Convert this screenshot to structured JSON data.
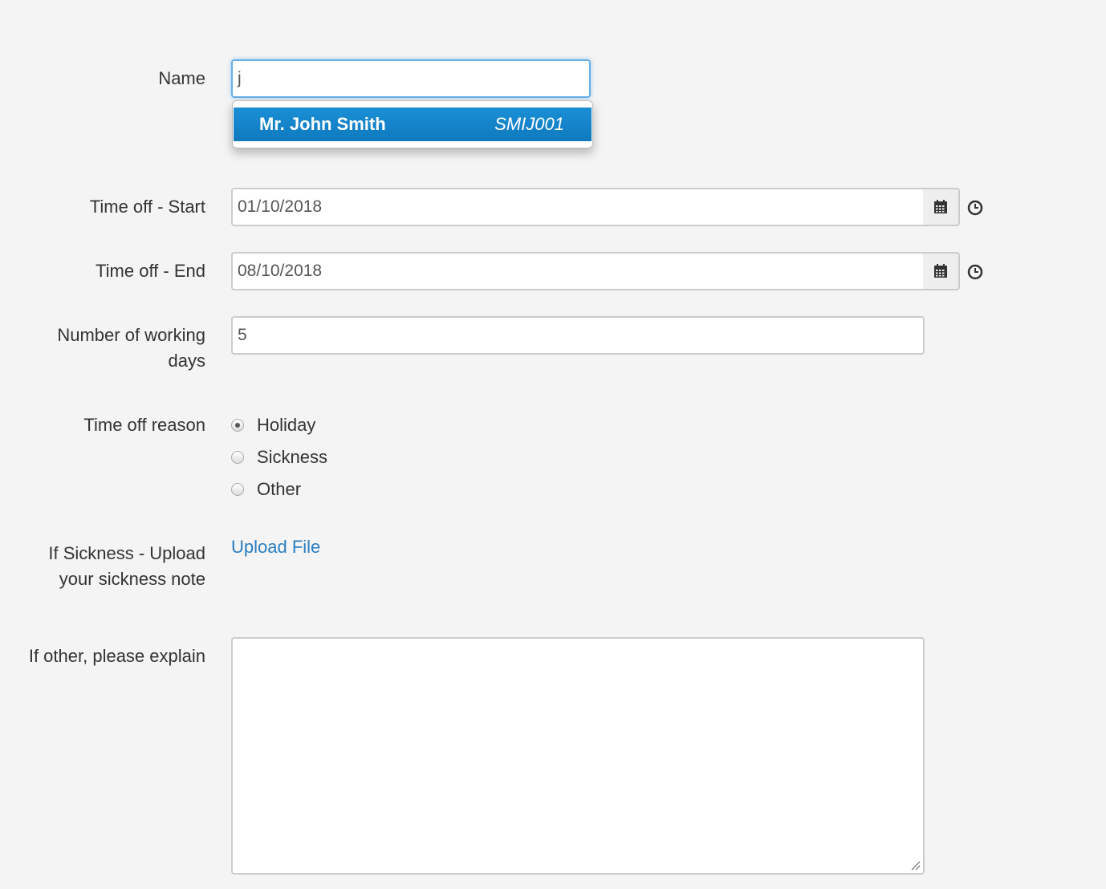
{
  "form": {
    "name": {
      "label": "Name",
      "value": "j"
    },
    "autocomplete": {
      "items": [
        {
          "name": "Mr. John Smith",
          "code": "SMIJ001"
        }
      ]
    },
    "start": {
      "label": "Time off - Start",
      "value": "01/10/2018",
      "calendar_icon": "calendar-icon",
      "clock_icon": "clock-icon"
    },
    "end": {
      "label": "Time off - End",
      "value": "08/10/2018",
      "calendar_icon": "calendar-icon",
      "clock_icon": "clock-icon"
    },
    "working_days": {
      "label": "Number of working days",
      "value": "5"
    },
    "reason": {
      "label": "Time off reason",
      "options": [
        {
          "label": "Holiday",
          "checked": true
        },
        {
          "label": "Sickness",
          "checked": false
        },
        {
          "label": "Other",
          "checked": false
        }
      ]
    },
    "upload": {
      "label": "If Sickness - Upload your sickness note",
      "link_text": "Upload File",
      "link_color": "#2a7dc0"
    },
    "explain": {
      "label": "If other, please explain",
      "value": ""
    }
  },
  "colors": {
    "background": "#f4f4f4",
    "dropdown_highlight": "#1584c9",
    "focus_border": "#66afe9"
  }
}
